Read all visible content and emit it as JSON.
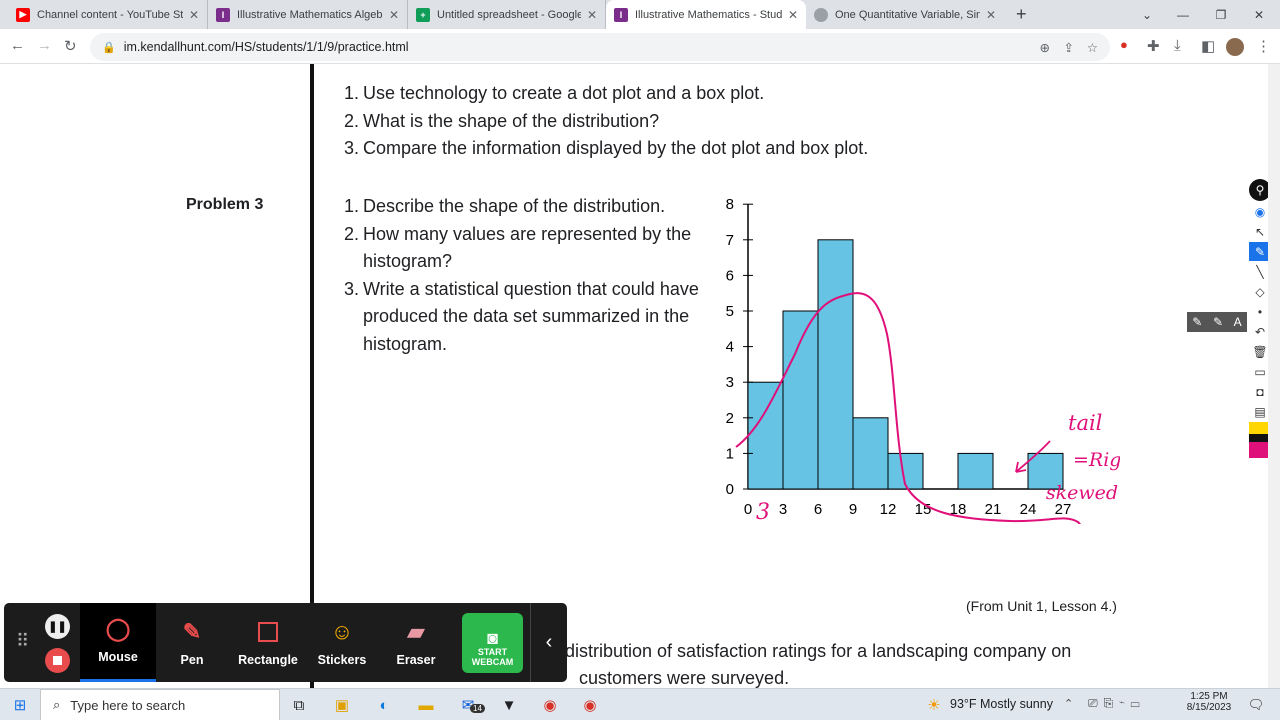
{
  "browser": {
    "tabs": [
      {
        "title": "Channel content - YouTube Studi",
        "icon": "youtube-icon"
      },
      {
        "title": "Illustrative Mathematics Algebra",
        "icon": "im-icon"
      },
      {
        "title": "Untitled spreadsheet - Google Sh",
        "icon": "sheets-icon"
      },
      {
        "title": "Illustrative Mathematics - Studen",
        "icon": "im-icon",
        "active": true
      },
      {
        "title": "One Quantitative Variable, Single",
        "icon": "globe-icon"
      }
    ],
    "url": "im.kendallhunt.com/HS/students/1/1/9/practice.html"
  },
  "page": {
    "problem2_items": [
      "Use technology to create a dot plot and a box plot.",
      "What is the shape of the distribution?",
      "Compare the information displayed by the dot plot and box plot."
    ],
    "problem3_label": "Problem 3",
    "problem3_items": [
      "Describe the shape of the distribution.",
      "How many values are represented by the histogram?",
      "Write a statistical question that could have produced the data set summarized in the histogram."
    ],
    "source": "(From Unit 1, Lesson 4.)",
    "problem4_line1": "distribution of satisfaction ratings for a landscaping company on",
    "problem4_line2": "customers were surveyed."
  },
  "chart_data": {
    "type": "bar",
    "bins": [
      "0-3",
      "3-6",
      "6-9",
      "9-12",
      "12-15",
      "15-18",
      "18-21",
      "21-24",
      "24-27"
    ],
    "values": [
      3,
      5,
      7,
      2,
      1,
      0,
      1,
      0,
      1
    ],
    "xticks": [
      0,
      3,
      6,
      9,
      12,
      15,
      18,
      21,
      24,
      27
    ],
    "yticks": [
      0,
      1,
      2,
      3,
      4,
      5,
      6,
      7,
      8
    ],
    "ylim": [
      0,
      8
    ],
    "bar_color": "#66c3e3",
    "annotations": [
      "3",
      "tail",
      "=Right",
      "skewed"
    ]
  },
  "recorder": {
    "buttons": [
      "Mouse",
      "Pen",
      "Rectangle",
      "Stickers",
      "Eraser"
    ],
    "webcam_label": "START WEBCAM"
  },
  "taskbar": {
    "search_placeholder": "Type here to search",
    "weather": "93°F  Mostly sunny",
    "time": "1:25 PM",
    "date": "8/15/2023",
    "mail_badge": "14"
  },
  "colors": {
    "ink": "#e0107a",
    "accent": "#1a73e8",
    "webcam": "#2db84d"
  }
}
